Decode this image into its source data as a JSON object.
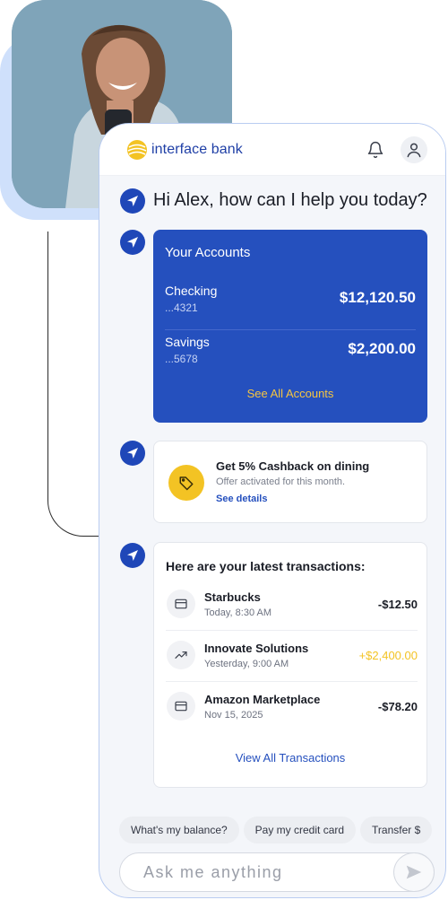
{
  "brand": {
    "name": "interface bank",
    "color": "#1f3fa6",
    "logo_color": "#f3c324"
  },
  "header": {
    "bell_icon": "bell-icon",
    "user_icon": "user-icon"
  },
  "greeting": "Hi Alex, how can I help you today?",
  "accounts": {
    "title": "Your Accounts",
    "items": [
      {
        "name": "Checking",
        "number": "...4321",
        "balance": "$12,120.50"
      },
      {
        "name": "Savings",
        "number": "...5678",
        "balance": "$2,200.00"
      }
    ],
    "see_all": "See All Accounts",
    "card_color": "#2550be"
  },
  "cashback": {
    "title": "Get 5% Cashback on dining",
    "subtitle": "Offer activated for this month.",
    "link": "See details",
    "icon": "tag-icon"
  },
  "transactions": {
    "title": "Here are your latest transactions:",
    "items": [
      {
        "name": "Starbucks",
        "date": "Today, 8:30 AM",
        "amount": "-$12.50",
        "icon": "credit-card-icon"
      },
      {
        "name": "Innovate Solutions",
        "date": "Yesterday, 9:00 AM",
        "amount": "+$2,400.00",
        "icon": "trending-up-icon"
      },
      {
        "name": "Amazon Marketplace",
        "date": "Nov 15, 2025",
        "amount": "-$78.20",
        "icon": "credit-card-icon"
      }
    ],
    "view_all": "View All Transactions"
  },
  "chips": [
    "What's my balance?",
    "Pay my credit card",
    "Transfer $"
  ],
  "input": {
    "placeholder": "Ask me anything"
  },
  "colors": {
    "accent": "#2550be",
    "positive": "#f3c324",
    "background": "#f4f6fa"
  }
}
